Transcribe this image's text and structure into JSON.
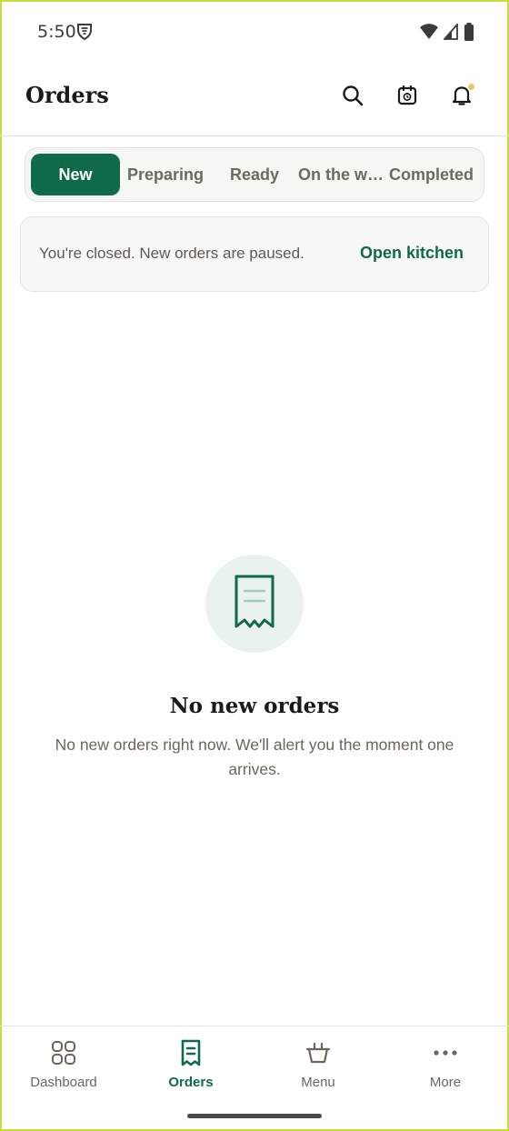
{
  "status_bar": {
    "time": "5:50"
  },
  "header": {
    "title": "Orders",
    "icons": [
      "search-icon",
      "calendar-icon",
      "bell-icon"
    ]
  },
  "tabs": [
    {
      "label": "New",
      "active": true
    },
    {
      "label": "Preparing",
      "active": false
    },
    {
      "label": "Ready",
      "active": false
    },
    {
      "label": "On the w…",
      "active": false
    },
    {
      "label": "Completed",
      "active": false
    }
  ],
  "banner": {
    "message": "You're closed. New orders are paused.",
    "action_label": "Open kitchen"
  },
  "empty_state": {
    "icon": "receipt-icon",
    "title": "No new orders",
    "description": "No new orders right now. We'll alert you the moment one arrives."
  },
  "bottom_nav": [
    {
      "label": "Dashboard",
      "icon": "dashboard-icon",
      "active": false
    },
    {
      "label": "Orders",
      "icon": "orders-icon",
      "active": true
    },
    {
      "label": "Menu",
      "icon": "menu-basket-icon",
      "active": false
    },
    {
      "label": "More",
      "icon": "more-icon",
      "active": false
    }
  ],
  "colors": {
    "brand_green": "#0f6b47",
    "notification_dot": "#e8c86a",
    "muted_text": "#6b665b"
  }
}
